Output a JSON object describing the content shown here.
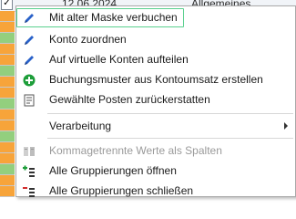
{
  "background": {
    "date": "12.06.2024",
    "text": "Allgemeines Tagesblatt",
    "row_colors": [
      "#f7a43a",
      "#f7a43a",
      "#93cf7e",
      "#f7a43a",
      "#f7a43a",
      "#93cf7e",
      "#f7a43a",
      "#f7a43a",
      "#93cf7e",
      "#f7a43a",
      "#f7a43a",
      "#93cf7e",
      "#f7a43a",
      "#f7a43a",
      "#93cf7e",
      "#f7a43a",
      "#f7a43a"
    ]
  },
  "menu": {
    "items": [
      {
        "label": "Mit alter Maske verbuchen",
        "icon": "pencil-icon",
        "highlighted": true
      },
      {
        "label": "Konto zuordnen",
        "icon": "pencil-icon"
      },
      {
        "label": "Auf virtuelle Konten aufteilen",
        "icon": "pencil-icon"
      },
      {
        "label": "Buchungsmuster aus Kontoumsatz erstellen",
        "icon": "add-circle-icon"
      },
      {
        "label": "Gewählte Posten zurückerstatten",
        "icon": "document-icon"
      },
      {
        "label": "Verarbeitung",
        "icon": "",
        "submenu": true
      },
      {
        "label": "Kommagetrennte Werte als Spalten",
        "icon": "columns-icon",
        "disabled": true
      },
      {
        "label": "Alle Gruppierungen öffnen",
        "icon": "expand-groups-icon"
      },
      {
        "label": "Alle Gruppierungen schließen",
        "icon": "collapse-groups-icon"
      }
    ]
  },
  "colors": {
    "accent_border": "#5ad08f",
    "pencil": "#2a62c9",
    "add": "#1e9e3a"
  }
}
